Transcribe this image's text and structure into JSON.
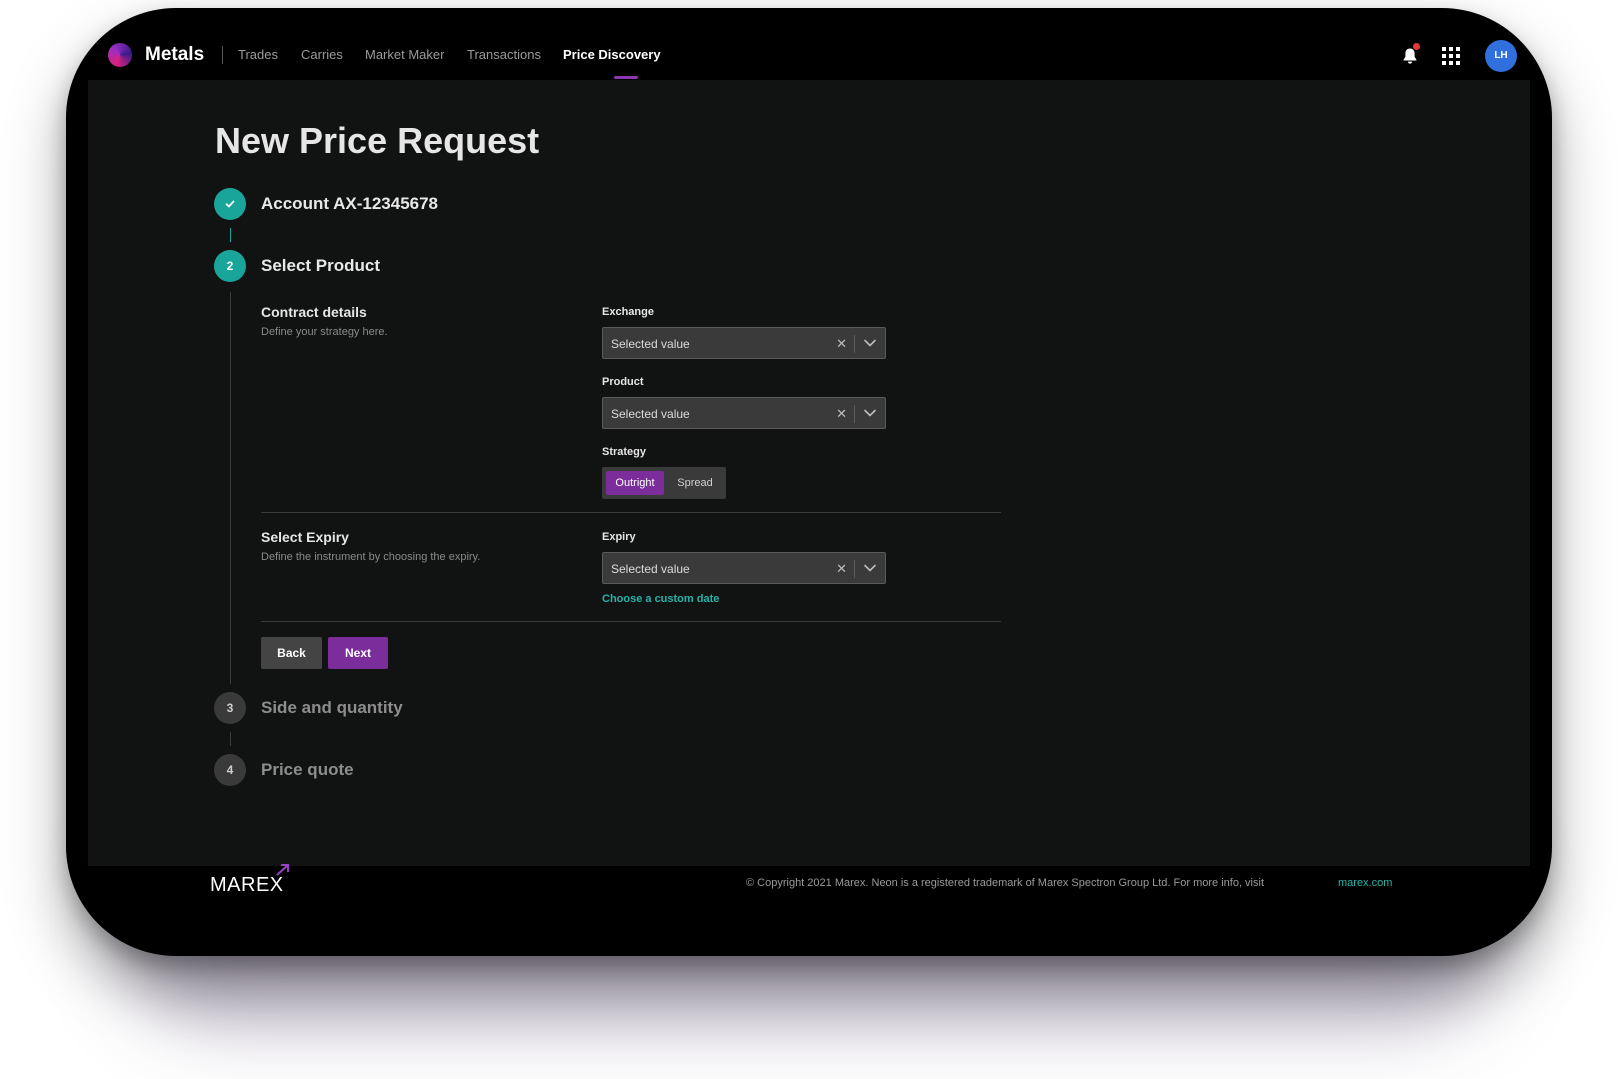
{
  "app": {
    "name": "Metals",
    "nav": [
      "Trades",
      "Carries",
      "Market Maker",
      "Transactions",
      "Price Discovery"
    ],
    "active_nav": "Price Discovery",
    "user_initials": "LH"
  },
  "page": {
    "title": "New Price Request"
  },
  "steps": [
    {
      "number": "",
      "title": "Account AX-12345678",
      "status": "done"
    },
    {
      "number": "2",
      "title": "Select Product",
      "status": "current"
    },
    {
      "number": "3",
      "title": "Side and quantity",
      "status": "todo"
    },
    {
      "number": "4",
      "title": "Price quote",
      "status": "todo"
    }
  ],
  "contract": {
    "title": "Contract details",
    "desc": "Define your strategy here.",
    "exchange_label": "Exchange",
    "exchange_value": "Selected value",
    "product_label": "Product",
    "product_value": "Selected value",
    "strategy_label": "Strategy",
    "strategy_options": [
      "Outright",
      "Spread"
    ],
    "strategy_selected": "Outright"
  },
  "expiry": {
    "title": "Select Expiry",
    "desc": "Define the instrument by choosing the expiry.",
    "label": "Expiry",
    "value": "Selected value",
    "custom_link": "Choose a custom date"
  },
  "buttons": {
    "back": "Back",
    "next": "Next"
  },
  "footer": {
    "logo": "MAREX",
    "copyright": "© Copyright 2021 Marex. Neon is a registered trademark of Marex Spectron Group Ltd. For more info, visit",
    "link": "marex.com"
  },
  "colors": {
    "accent_purple": "#7b2e9b",
    "teal": "#1aa59b",
    "background": "#111212"
  }
}
